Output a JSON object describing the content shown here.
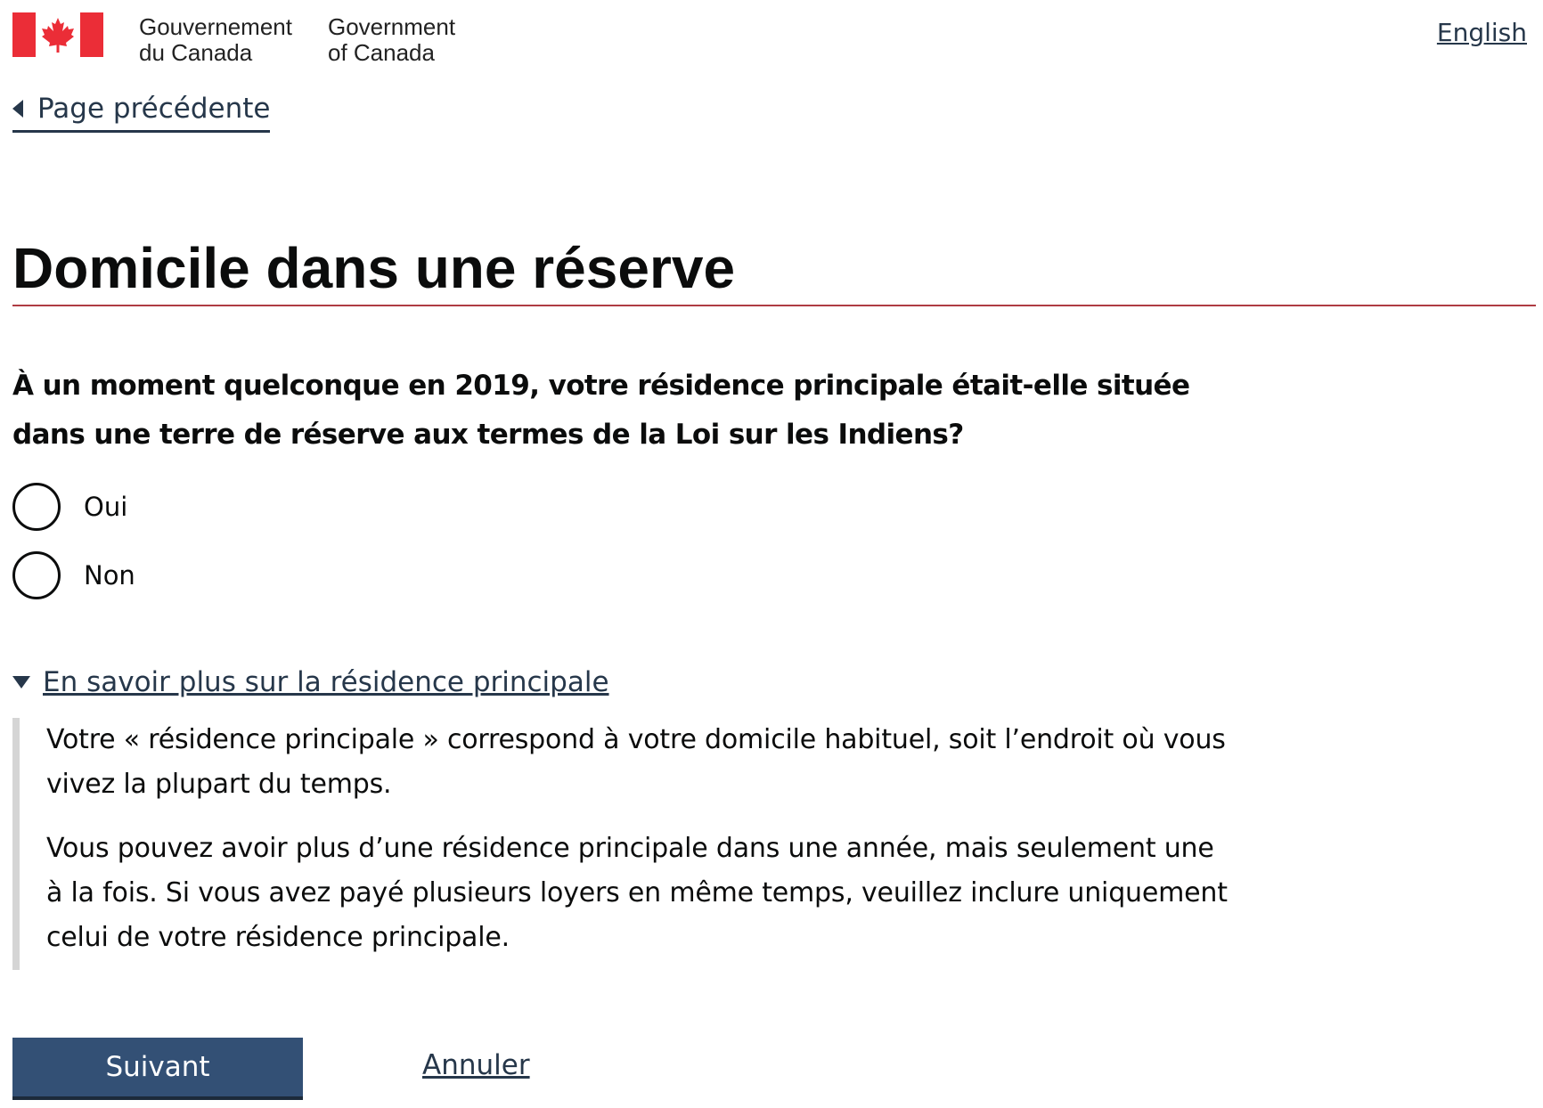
{
  "header": {
    "wordmark_fr": [
      "Gouvernement",
      "du Canada"
    ],
    "wordmark_en": [
      "Government",
      "of Canada"
    ],
    "language_link": "English"
  },
  "nav": {
    "back_label": "Page précédente"
  },
  "main": {
    "title": "Domicile dans une réserve",
    "question": "À un moment quelconque en 2019, votre résidence principale était-elle située dans une terre de réserve aux termes de la Loi sur les Indiens?",
    "options": [
      {
        "label": "Oui",
        "selected": false
      },
      {
        "label": "Non",
        "selected": false
      }
    ],
    "details": {
      "summary": "En savoir plus sur la résidence principale",
      "expanded": true,
      "paragraphs": [
        "Votre « résidence principale » correspond à votre domicile habituel, soit l’endroit où vous vivez la plupart du temps.",
        "Vous pouvez avoir plus d’une résidence principale dans une année, mais seulement une à la fois. Si vous avez payé plusieurs loyers en même temps, veuillez inclure uniquement celui de votre résidence principale."
      ]
    }
  },
  "actions": {
    "next_label": "Suivant",
    "cancel_label": "Annuler"
  },
  "colors": {
    "flag_red": "#eb2d37",
    "link": "#26374a",
    "primary_button": "#335075",
    "title_rule": "#af3c43",
    "details_border": "#d5d5d5"
  },
  "icons": {
    "flag": "canada-flag-icon",
    "back": "caret-left-icon",
    "details_toggle": "caret-down-icon"
  }
}
